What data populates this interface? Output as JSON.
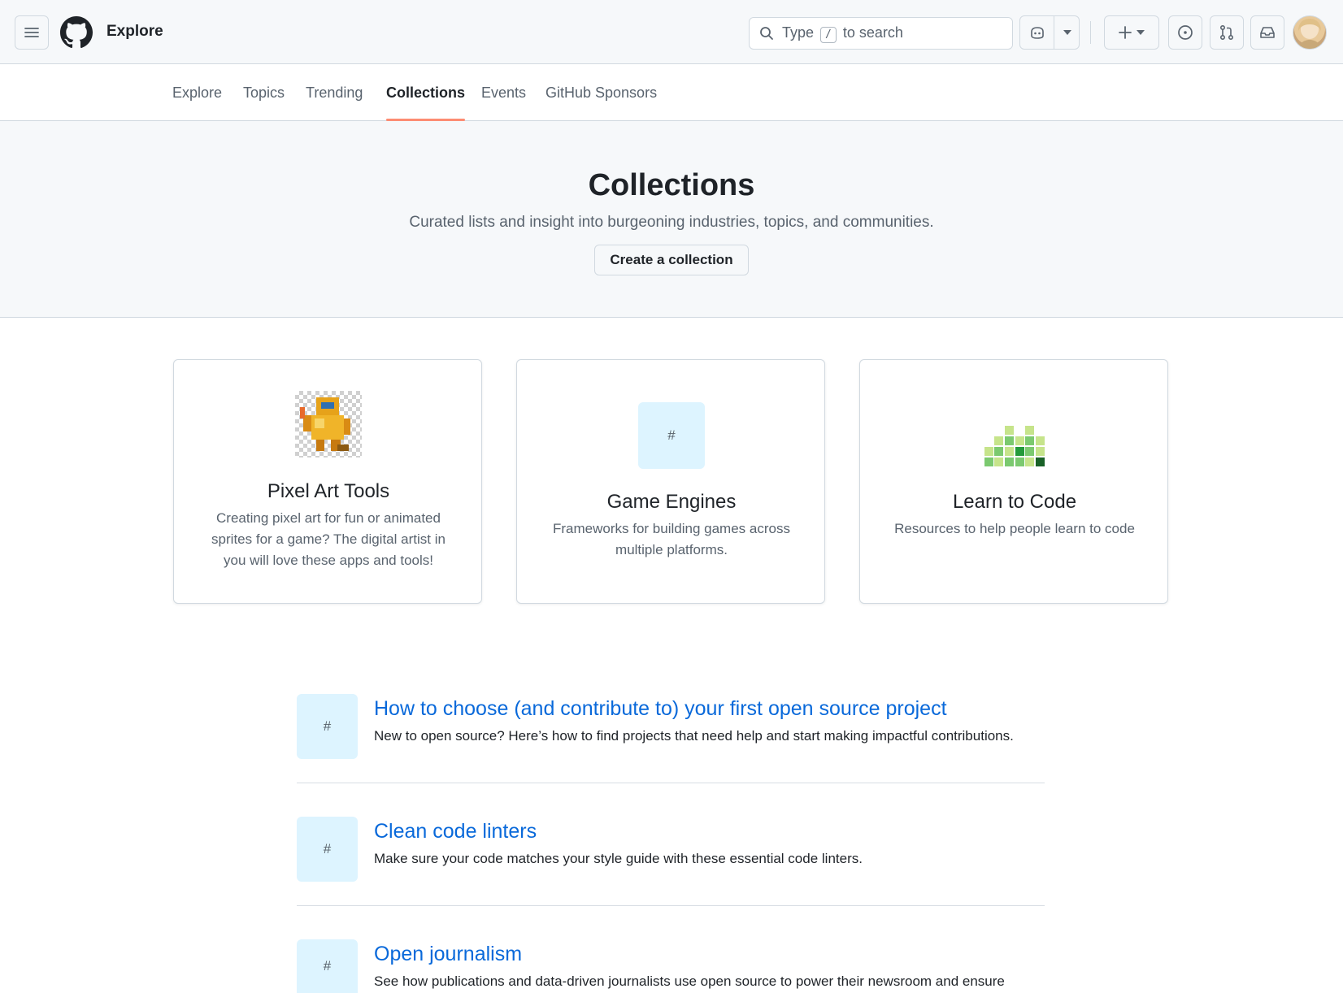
{
  "header": {
    "menu_icon": "hamburger-icon",
    "logo_icon": "github-mark-icon",
    "breadcrumb": "Explore",
    "search": {
      "placeholder_before": "Type",
      "placeholder_key": "/",
      "placeholder_after": "to search"
    },
    "copilot_icon": "copilot-icon",
    "create_icon": "plus-icon",
    "issues_icon": "issue-opened-icon",
    "pulls_icon": "git-pull-request-icon",
    "inbox_icon": "inbox-icon",
    "avatar_icon": "user-avatar"
  },
  "subnav": {
    "tabs": [
      {
        "label": "Explore",
        "active": false
      },
      {
        "label": "Topics",
        "active": false
      },
      {
        "label": "Trending",
        "active": false
      },
      {
        "label": "Collections",
        "active": true
      },
      {
        "label": "Events",
        "active": false
      },
      {
        "label": "GitHub Sponsors",
        "active": false
      }
    ],
    "active_underline_color": "#fd8c73"
  },
  "hero": {
    "title": "Collections",
    "subtitle": "Curated lists and insight into burgeoning industries, topics, and communities.",
    "button": "Create a collection"
  },
  "featured": [
    {
      "title": "Pixel Art Tools",
      "description": "Creating pixel art for fun or animated sprites for a game? The digital artist in you will love these apps and tools!",
      "image": "pixel-robot-image"
    },
    {
      "title": "Game Engines",
      "description": "Frameworks for building games across multiple platforms.",
      "image": "#"
    },
    {
      "title": "Learn to Code",
      "description": "Resources to help people learn to code",
      "image": "green-blocks-image"
    }
  ],
  "collections": [
    {
      "thumb": "#",
      "title": "How to choose (and contribute to) your first open source project",
      "description": "New to open source? Here’s how to find projects that need help and start making impactful contributions."
    },
    {
      "thumb": "#",
      "title": "Clean code linters",
      "description": "Make sure your code matches your style guide with these essential code linters."
    },
    {
      "thumb": "#",
      "title": "Open journalism",
      "description": "See how publications and data-driven journalists use open source to power their newsroom and ensure"
    }
  ],
  "colors": {
    "link": "#0969da",
    "tile_bg": "#ddf4ff",
    "muted_text": "#59636e",
    "border": "#d1d9e0"
  }
}
